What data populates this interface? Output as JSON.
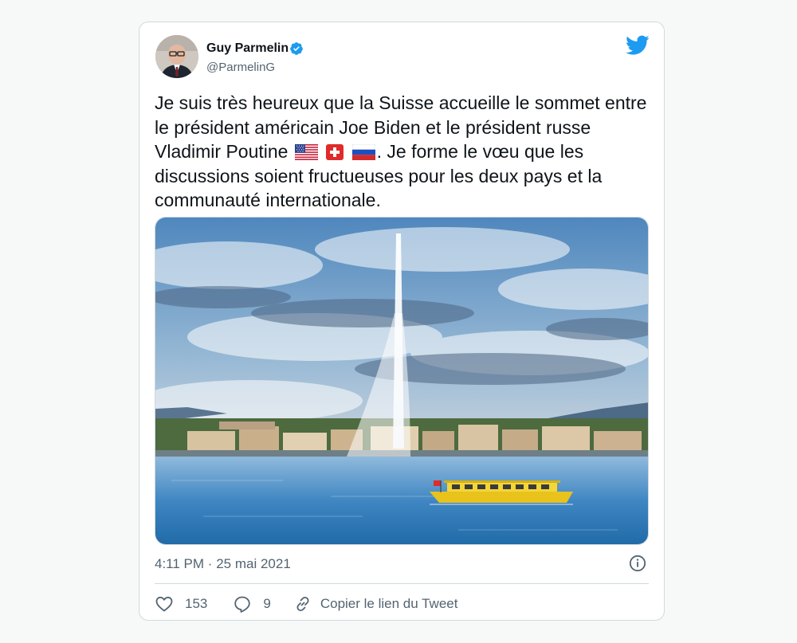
{
  "author": {
    "name": "Guy Parmelin",
    "handle": "@ParmelinG",
    "verified": true,
    "avatar_icon": "portrait-avatar"
  },
  "tweet": {
    "text_before_flags": "Je suis très heureux que la Suisse accueille le sommet entre le président américain Joe Biden et le président russe Vladimir Poutine",
    "flags": [
      "us-flag-icon",
      "swiss-flag-icon",
      "russia-flag-icon"
    ],
    "text_after_flags": ". Je forme le vœu que les discussions soient fructueuses pour les deux pays et la communauté internationale.",
    "image_icon": "geneva-jet-deau-photo"
  },
  "meta": {
    "time": "4:11 PM",
    "separator": "·",
    "date": "25 mai 2021"
  },
  "actions": {
    "likes": "153",
    "replies": "9",
    "copy_link_label": "Copier le lien du Tweet"
  },
  "colors": {
    "twitter_blue": "#1d9bf0",
    "text": "#0f1419",
    "secondary_text": "#536471",
    "border": "#cfd9de"
  }
}
